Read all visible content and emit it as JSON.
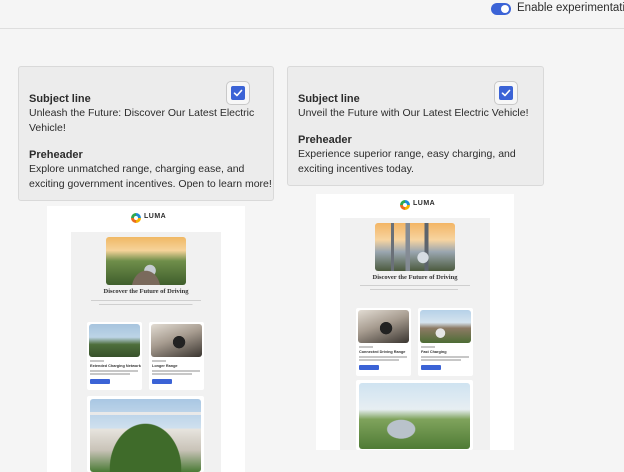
{
  "header": {
    "toggle": {
      "label": "Enable experimentation",
      "on": true
    }
  },
  "colors": {
    "accent": "#3b63d6",
    "card_bg": "#ececec",
    "page_bg": "#f5f5f5"
  },
  "variants": [
    {
      "subject_heading": "Subject line",
      "subject_line1": "Unleash the Future: Discover Our Latest Electric",
      "subject_line2": "Vehicle!",
      "preheader_heading": "Preheader",
      "preheader_line1": "Explore unmatched range, charging ease, and",
      "preheader_line2": "exciting government incentives. Open to learn more!",
      "selected": true,
      "preview": {
        "logo": "LUMA",
        "headline": "Discover the Future of Driving",
        "card_left_title": "Extended Charging Network",
        "card_right_title": "Longer Range"
      }
    },
    {
      "subject_heading": "Subject line",
      "subject_line1": "Unveil the Future with Our Latest Electric Vehicle!",
      "preheader_heading": "Preheader",
      "preheader_line1": "Experience superior range, easy charging, and",
      "preheader_line2": "exciting incentives today.",
      "selected": true,
      "preview": {
        "logo": "LUMA",
        "headline": "Discover the Future of Driving",
        "card_left_title": "Connected Driving Range",
        "card_right_title": "Fast Charging"
      }
    }
  ]
}
